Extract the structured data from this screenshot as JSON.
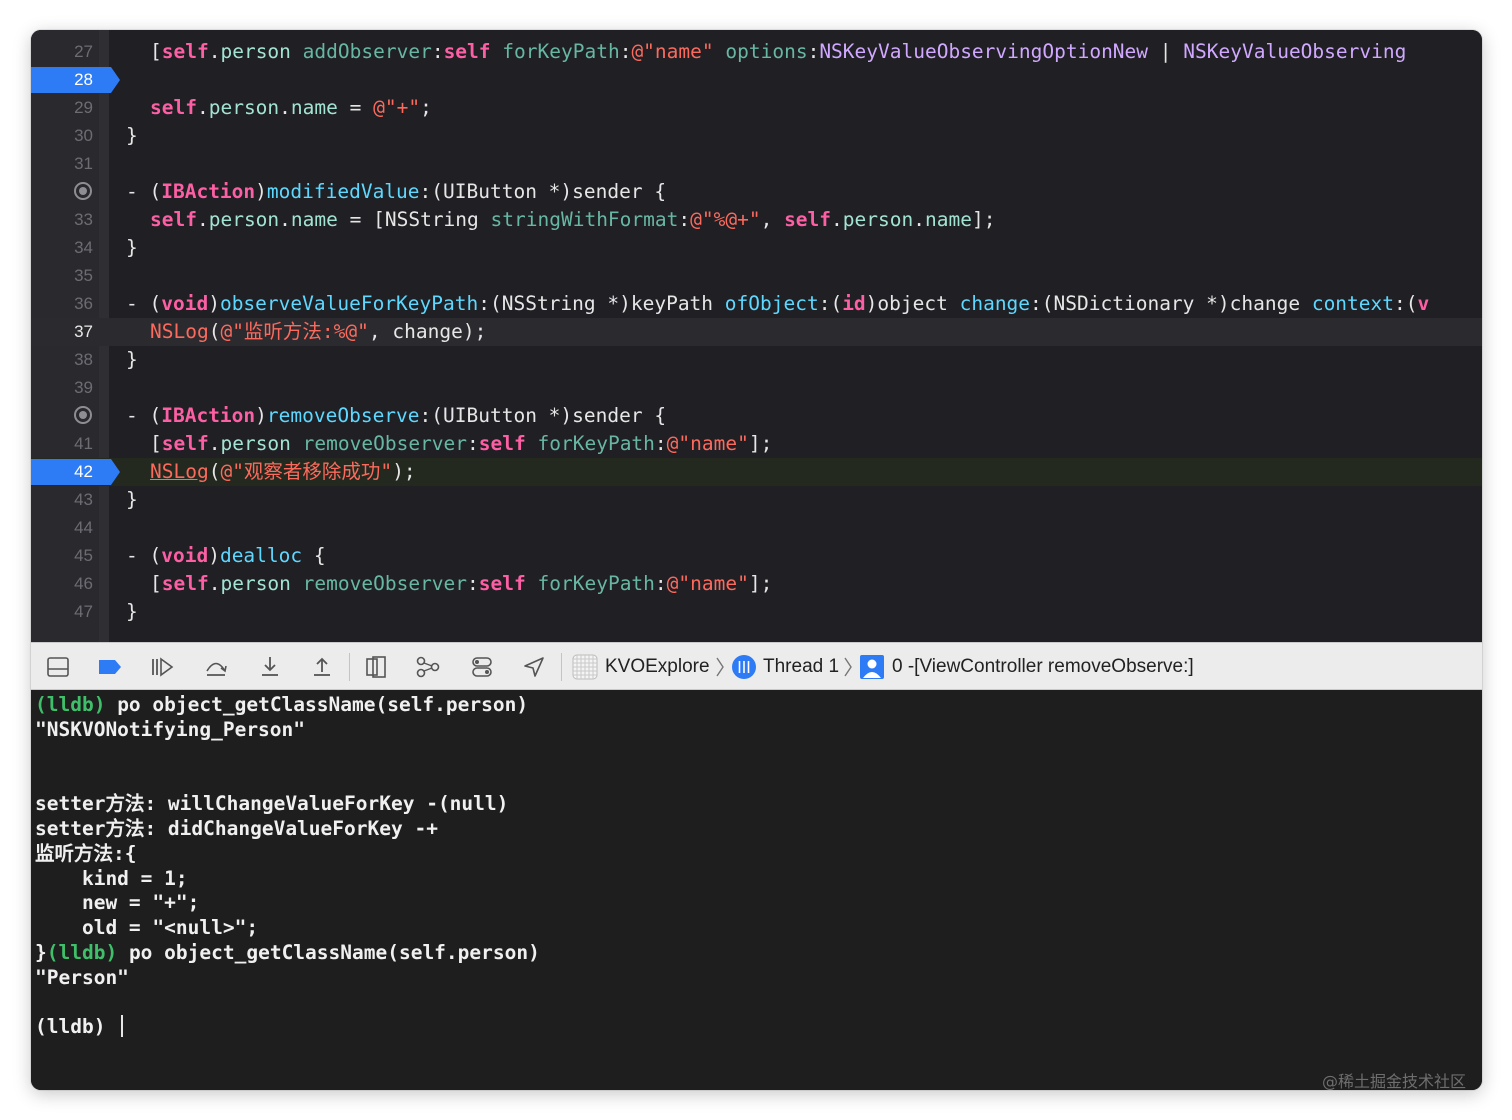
{
  "editor": {
    "lines": [
      {
        "num": "27",
        "code": [
          [
            "[",
            ""
          ],
          [
            "self",
            "k"
          ],
          [
            ".",
            ""
          ],
          [
            "person",
            "p"
          ],
          [
            " ",
            ""
          ],
          [
            "addObserver",
            "m"
          ],
          [
            ":",
            ""
          ],
          [
            "self",
            "k"
          ],
          [
            " ",
            ""
          ],
          [
            "forKeyPath",
            "m"
          ],
          [
            ":",
            ""
          ],
          [
            "@\"name\"",
            "s"
          ],
          [
            " ",
            ""
          ],
          [
            "options",
            "m"
          ],
          [
            ":",
            ""
          ],
          [
            "NSKeyValueObservingOptionNew",
            "t"
          ],
          [
            " | ",
            ""
          ],
          [
            "NSKeyValueObserving",
            "t"
          ]
        ]
      },
      {
        "num": "28",
        "breakpoint": true,
        "code": []
      },
      {
        "num": "29",
        "code": [
          [
            "self",
            "k"
          ],
          [
            ".",
            ""
          ],
          [
            "person",
            "p"
          ],
          [
            ".",
            ""
          ],
          [
            "name",
            "p"
          ],
          [
            " = ",
            ""
          ],
          [
            "@\"+\"",
            "s"
          ],
          [
            ";",
            ""
          ]
        ]
      },
      {
        "num": "30",
        "code": [
          [
            "}",
            ""
          ]
        ]
      },
      {
        "num": "31",
        "code": []
      },
      {
        "num": "32",
        "action": true,
        "code": [
          [
            "- (",
            ""
          ],
          [
            "IBAction",
            "k"
          ],
          [
            ")",
            ""
          ],
          [
            "modifiedValue",
            "d"
          ],
          [
            ":(",
            ""
          ],
          [
            "UIButton",
            ""
          ],
          [
            " *)sender {",
            ""
          ]
        ]
      },
      {
        "num": "33",
        "code": [
          [
            "self",
            "k"
          ],
          [
            ".",
            ""
          ],
          [
            "person",
            "p"
          ],
          [
            ".",
            ""
          ],
          [
            "name",
            "p"
          ],
          [
            " = [",
            ""
          ],
          [
            "NSString",
            ""
          ],
          [
            " ",
            ""
          ],
          [
            "stringWithFormat",
            "m"
          ],
          [
            ":",
            ""
          ],
          [
            "@\"%@+\"",
            "s"
          ],
          [
            ", ",
            ""
          ],
          [
            "self",
            "k"
          ],
          [
            ".",
            ""
          ],
          [
            "person",
            "p"
          ],
          [
            ".",
            ""
          ],
          [
            "name",
            "p"
          ],
          [
            "];",
            ""
          ]
        ]
      },
      {
        "num": "34",
        "code": [
          [
            "}",
            ""
          ]
        ]
      },
      {
        "num": "35",
        "code": []
      },
      {
        "num": "36",
        "code": [
          [
            "- (",
            ""
          ],
          [
            "void",
            "k"
          ],
          [
            ")",
            ""
          ],
          [
            "observeValueForKeyPath",
            "d"
          ],
          [
            ":(",
            ""
          ],
          [
            "NSString",
            ""
          ],
          [
            " *)keyPath ",
            ""
          ],
          [
            "ofObject",
            "d"
          ],
          [
            ":(",
            ""
          ],
          [
            "id",
            "k"
          ],
          [
            ")object ",
            ""
          ],
          [
            "change",
            "d"
          ],
          [
            ":(",
            ""
          ],
          [
            "NSDictionary",
            ""
          ],
          [
            " *)change ",
            ""
          ],
          [
            "context",
            "d"
          ],
          [
            ":(",
            ""
          ],
          [
            "v",
            "k"
          ]
        ]
      },
      {
        "num": "37",
        "current": true,
        "code": [
          [
            "NSLog",
            "s"
          ],
          [
            "(",
            ""
          ],
          [
            "@\"监听方法:%@\"",
            "s"
          ],
          [
            ", change);",
            ""
          ]
        ]
      },
      {
        "num": "38",
        "code": [
          [
            "}",
            ""
          ]
        ]
      },
      {
        "num": "39",
        "code": []
      },
      {
        "num": "40",
        "action": true,
        "code": [
          [
            "- (",
            ""
          ],
          [
            "IBAction",
            "k"
          ],
          [
            ")",
            ""
          ],
          [
            "removeObserve",
            "d"
          ],
          [
            ":(",
            ""
          ],
          [
            "UIButton",
            ""
          ],
          [
            " *)sender {",
            ""
          ]
        ]
      },
      {
        "num": "41",
        "code": [
          [
            "[",
            ""
          ],
          [
            "self",
            "k"
          ],
          [
            ".",
            ""
          ],
          [
            "person",
            "p"
          ],
          [
            " ",
            ""
          ],
          [
            "removeObserver",
            "m"
          ],
          [
            ":",
            ""
          ],
          [
            "self",
            "k"
          ],
          [
            " ",
            ""
          ],
          [
            "forKeyPath",
            "m"
          ],
          [
            ":",
            ""
          ],
          [
            "@\"name\"",
            "s"
          ],
          [
            "];",
            ""
          ]
        ]
      },
      {
        "num": "42",
        "breakpoint": true,
        "green": true,
        "code": [
          [
            "NSLog",
            "s u"
          ],
          [
            "(",
            ""
          ],
          [
            "@\"观察者移除成功\"",
            "s"
          ],
          [
            ");",
            ""
          ]
        ]
      },
      {
        "num": "43",
        "code": [
          [
            "}",
            ""
          ]
        ]
      },
      {
        "num": "44",
        "code": []
      },
      {
        "num": "45",
        "code": [
          [
            "- (",
            ""
          ],
          [
            "void",
            "k"
          ],
          [
            ")",
            ""
          ],
          [
            "dealloc",
            "d"
          ],
          [
            " {",
            ""
          ]
        ]
      },
      {
        "num": "46",
        "code": [
          [
            "[",
            ""
          ],
          [
            "self",
            "k"
          ],
          [
            ".",
            ""
          ],
          [
            "person",
            "p"
          ],
          [
            " ",
            ""
          ],
          [
            "removeObserver",
            "m"
          ],
          [
            ":",
            ""
          ],
          [
            "self",
            "k"
          ],
          [
            " ",
            ""
          ],
          [
            "forKeyPath",
            "m"
          ],
          [
            ":",
            ""
          ],
          [
            "@\"name\"",
            "s"
          ],
          [
            "];",
            ""
          ]
        ]
      },
      {
        "num": "47",
        "code": [
          [
            "}",
            ""
          ]
        ]
      }
    ]
  },
  "toolbar": {
    "icons": [
      "hide-debug-area-icon",
      "breakpoints-toggle-icon",
      "continue-icon",
      "step-over-icon",
      "step-into-icon",
      "step-out-icon",
      "view-hierarchy-icon",
      "memory-graph-icon",
      "environment-overrides-icon",
      "simulate-location-icon"
    ],
    "app_name": "KVOExplore",
    "thread_label": "Thread 1",
    "frame_label": "0 -[ViewController removeObserve:]"
  },
  "console": {
    "lines": [
      [
        [
          "(lldb)",
          "lldb"
        ],
        [
          " po object_getClassName(self.person)",
          ""
        ]
      ],
      [
        [
          "\"NSKVONotifying_Person\"",
          ""
        ]
      ],
      [],
      [],
      [
        [
          "setter方法: willChangeValueForKey -(null)",
          ""
        ]
      ],
      [
        [
          "setter方法: didChangeValueForKey -+",
          ""
        ]
      ],
      [
        [
          "监听方法:{",
          ""
        ]
      ],
      [
        [
          "    kind = 1;",
          ""
        ]
      ],
      [
        [
          "    new = \"+\";",
          ""
        ]
      ],
      [
        [
          "    old = \"<null>\";",
          ""
        ]
      ],
      [
        [
          "}",
          ""
        ],
        [
          "(lldb)",
          "lldb"
        ],
        [
          " po object_getClassName(self.person)",
          ""
        ]
      ],
      [
        [
          "\"Person\"",
          ""
        ]
      ],
      [],
      [
        [
          "(lldb) ",
          ""
        ]
      ]
    ]
  },
  "watermark": "@稀土掘金技术社区",
  "colors": {
    "editor_bg": "#1f1f24",
    "keyword": "#fc5fa3",
    "string": "#fc6a5d",
    "method": "#67b7a4",
    "declaration": "#5dd8ff",
    "type_constant": "#d0a8ff",
    "breakpoint": "#2d7bf5",
    "lldb_prompt": "#3fbf6a"
  }
}
